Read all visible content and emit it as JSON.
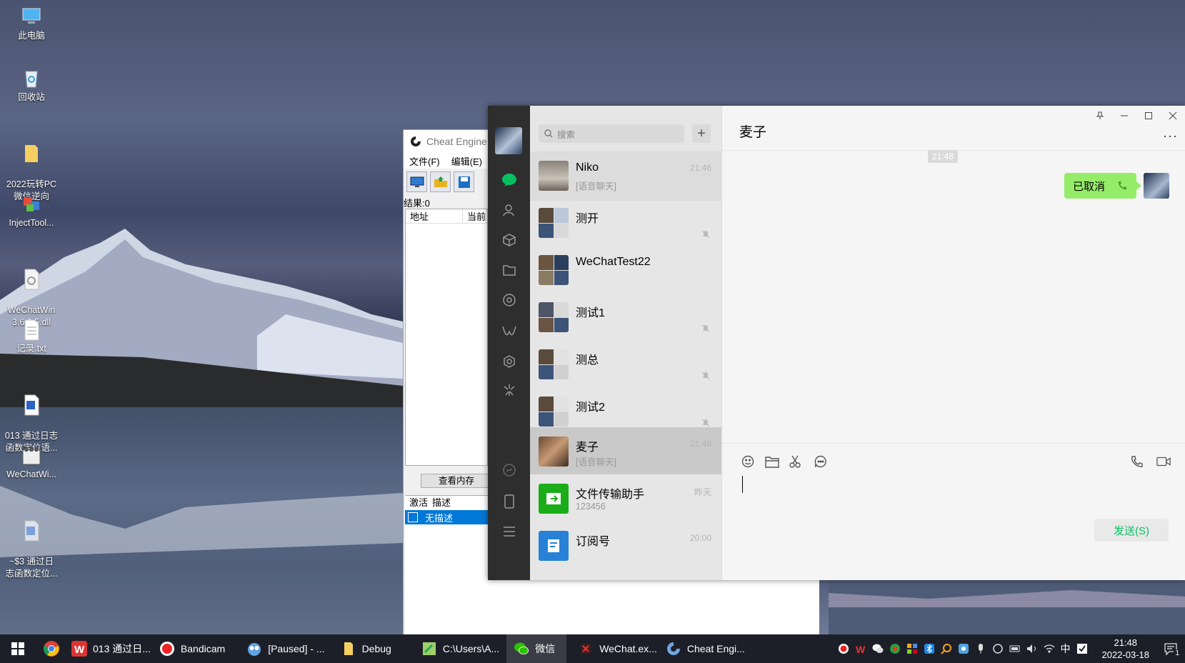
{
  "desktop": {
    "icons": [
      {
        "label": "此电脑",
        "icon": "computer-icon"
      },
      {
        "label": "回收站",
        "icon": "recycle-bin-icon"
      },
      {
        "label": "2022玩转PC\n微信逆向",
        "icon": "folder-icon"
      },
      {
        "label": "InjectTool...",
        "icon": "app-icon"
      },
      {
        "label": "WeChatWin\n3.6.0.5.dll",
        "icon": "dll-file-icon"
      },
      {
        "label": "记录.txt",
        "icon": "text-file-icon"
      },
      {
        "label": "013 通过日志\n函数定位语...",
        "icon": "word-doc-icon"
      },
      {
        "label": "WeChatWi...",
        "icon": "app-icon"
      },
      {
        "label": "~$3 通过日\n志函数定位...",
        "icon": "word-doc-icon"
      }
    ]
  },
  "cheat_engine": {
    "title": "Cheat Engine",
    "menu": [
      "文件(F)",
      "编辑(E)"
    ],
    "results_label": "结果:0",
    "columns": [
      "地址",
      "当前"
    ],
    "memory_view_button": "查看内存",
    "lower_columns": [
      "激活",
      "描述"
    ],
    "selected_row": "无描述"
  },
  "wechat": {
    "search_placeholder": "搜索",
    "add_button": "+",
    "chats": [
      {
        "name": "Niko",
        "preview": "[语音聊天]",
        "time": "21:46",
        "muted": false
      },
      {
        "name": "测开",
        "preview": "",
        "time": "",
        "muted": true
      },
      {
        "name": "WeChatTest22",
        "preview": "",
        "time": "",
        "muted": false
      },
      {
        "name": "测试1",
        "preview": "",
        "time": "",
        "muted": true
      },
      {
        "name": "测总",
        "preview": "",
        "time": "",
        "muted": true
      },
      {
        "name": "测试2",
        "preview": "",
        "time": "",
        "muted": true
      },
      {
        "name": "麦子",
        "preview": "[语音聊天]",
        "time": "21:48",
        "muted": false
      },
      {
        "name": "文件传输助手",
        "preview": "123456",
        "time": "昨天",
        "muted": false
      },
      {
        "name": "订阅号",
        "preview": "",
        "time": "20:00",
        "muted": false
      }
    ],
    "chat_title": "麦子",
    "more": "···",
    "timestamp": "21:48",
    "message": "已取消",
    "send_button": "发送(S)",
    "accent": "#07c160",
    "bubble_color": "#95ec69"
  },
  "taskbar": {
    "items": [
      {
        "label": "",
        "icon": "windows-start-icon"
      },
      {
        "label": "",
        "icon": "chrome-icon"
      },
      {
        "label": "013 通过日...",
        "icon": "wps-icon"
      },
      {
        "label": "Bandicam",
        "icon": "bandicam-record-icon"
      },
      {
        "label": "[Paused] - ...",
        "icon": "owl-icon"
      },
      {
        "label": "Debug",
        "icon": "folder-icon"
      },
      {
        "label": "C:\\Users\\A...",
        "icon": "notepad-icon"
      },
      {
        "label": "微信",
        "icon": "wechat-icon"
      },
      {
        "label": "WeChat.ex...",
        "icon": "debugger-icon"
      },
      {
        "label": "Cheat Engi...",
        "icon": "cheat-engine-icon"
      }
    ],
    "ime": "中",
    "time": "21:48",
    "date": "2022-03-18",
    "notification_count": "1"
  }
}
